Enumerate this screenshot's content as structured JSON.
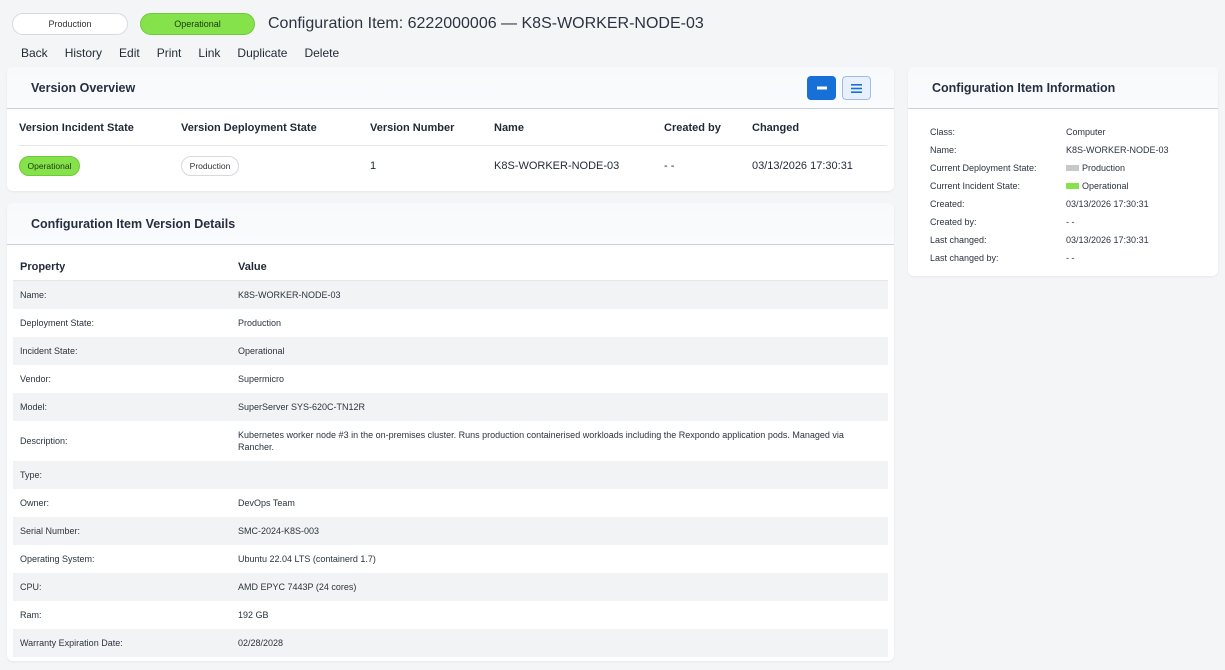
{
  "header": {
    "deployment_pill": "Production",
    "incident_pill": "Operational",
    "title": "Configuration Item: 6222000006 — K8S-WORKER-NODE-03"
  },
  "actions": [
    "Back",
    "History",
    "Edit",
    "Print",
    "Link",
    "Duplicate",
    "Delete"
  ],
  "overview": {
    "title": "Version Overview",
    "columns": [
      "Version Incident State",
      "Version Deployment State",
      "Version Number",
      "Name",
      "Created by",
      "Changed"
    ],
    "row": {
      "incident_state": "Operational",
      "deployment_state": "Production",
      "version_number": "1",
      "name": "K8S-WORKER-NODE-03",
      "created_by": "- -",
      "changed": "03/13/2026 17:30:31"
    }
  },
  "details": {
    "title": "Configuration Item Version Details",
    "columns": [
      "Property",
      "Value"
    ],
    "rows": [
      {
        "property": "Name:",
        "value": "K8S-WORKER-NODE-03"
      },
      {
        "property": "Deployment State:",
        "value": "Production"
      },
      {
        "property": "Incident State:",
        "value": "Operational"
      },
      {
        "property": "Vendor:",
        "value": "Supermicro"
      },
      {
        "property": "Model:",
        "value": "SuperServer SYS-620C-TN12R"
      },
      {
        "property": "Description:",
        "value": "Kubernetes worker node #3 in the on-premises cluster. Runs production containerised workloads including the Rexpondo application pods. Managed via Rancher."
      },
      {
        "property": "Type:",
        "value": ""
      },
      {
        "property": "Owner:",
        "value": "DevOps Team"
      },
      {
        "property": "Serial Number:",
        "value": "SMC-2024-K8S-003"
      },
      {
        "property": "Operating System:",
        "value": "Ubuntu 22.04 LTS (containerd 1.7)"
      },
      {
        "property": "CPU:",
        "value": "AMD EPYC 7443P (24 cores)"
      },
      {
        "property": "Ram:",
        "value": "192 GB"
      },
      {
        "property": "Warranty Expiration Date:",
        "value": "02/28/2028"
      }
    ]
  },
  "info": {
    "title": "Configuration Item Information",
    "class_label": "Class:",
    "class_value": "Computer",
    "name_label": "Name:",
    "name_value": "K8S-WORKER-NODE-03",
    "deploy_label": "Current Deployment State:",
    "deploy_value": "Production",
    "incident_label": "Current Incident State:",
    "incident_value": "Operational",
    "created_label": "Created:",
    "created_value": "03/13/2026 17:30:31",
    "created_by_label": "Created by:",
    "created_by_value": "- -",
    "changed_label": "Last changed:",
    "changed_value": "03/13/2026 17:30:31",
    "changed_by_label": "Last changed by:",
    "changed_by_value": "- -"
  },
  "colors": {
    "operational": "#86e24a",
    "production": "#c8c8c8",
    "primary": "#1670d8"
  }
}
